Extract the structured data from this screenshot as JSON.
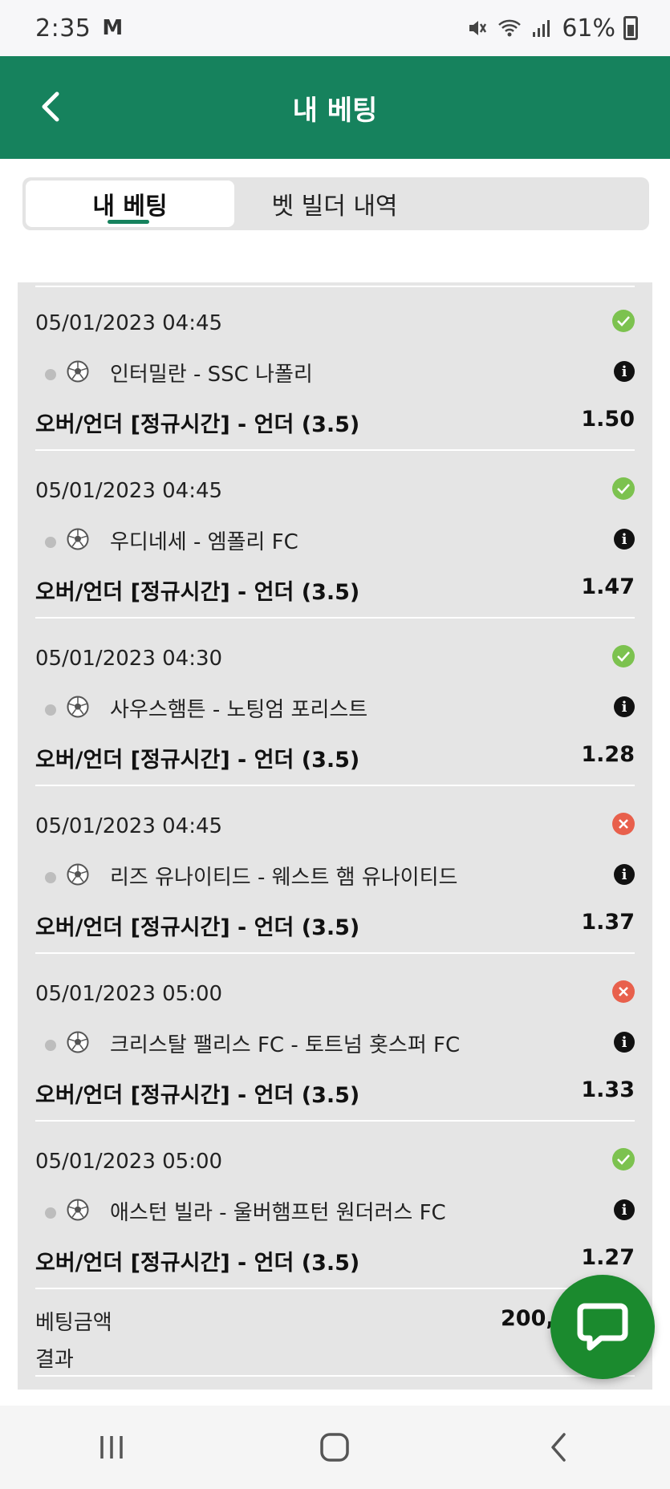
{
  "status_bar": {
    "time": "2:35",
    "mail_icon": "M",
    "battery": "61%"
  },
  "header": {
    "title": "내 베팅"
  },
  "tabs": [
    {
      "label": "내 베팅",
      "active": true
    },
    {
      "label": "벳 빌더 내역",
      "active": false
    }
  ],
  "bets": [
    {
      "date": "05/01/2023 04:45",
      "match": "인터밀란 - SSC 나폴리",
      "market": "오버/언더 [정규시간] - 언더 (3.5)",
      "odds": "1.50",
      "result": "win"
    },
    {
      "date": "05/01/2023 04:45",
      "match": "우디네세 - 엠폴리 FC",
      "market": "오버/언더 [정규시간] - 언더 (3.5)",
      "odds": "1.47",
      "result": "win"
    },
    {
      "date": "05/01/2023 04:30",
      "match": "사우스햄튼 - 노팅엄 포리스트",
      "market": "오버/언더 [정규시간] - 언더 (3.5)",
      "odds": "1.28",
      "result": "win"
    },
    {
      "date": "05/01/2023 04:45",
      "match": "리즈 유나이티드 - 웨스트 햄 유나이티드",
      "market": "오버/언더 [정규시간] - 언더 (3.5)",
      "odds": "1.37",
      "result": "loss"
    },
    {
      "date": "05/01/2023 05:00",
      "match": "크리스탈 팰리스 FC - 토트넘 홋스퍼 FC",
      "market": "오버/언더 [정규시간] - 언더 (3.5)",
      "odds": "1.33",
      "result": "loss"
    },
    {
      "date": "05/01/2023 05:00",
      "match": "애스턴 빌라 - 울버햄프턴 원더러스 FC",
      "market": "오버/언더 [정규시간] - 언더 (3.5)",
      "odds": "1.27",
      "result": "win"
    }
  ],
  "summary": {
    "stake_label": "베팅금액",
    "stake_value": "200,0",
    "result_label": "결과"
  },
  "colors": {
    "brand_green": "#16825d",
    "win": "#7cc24f",
    "loss": "#e8604c",
    "chat_fab": "#1b8a2e"
  },
  "icons": {
    "back": "chevron-left-icon",
    "status_win": "check-icon",
    "status_loss": "x-icon",
    "sport": "soccer-ball-icon",
    "info": "info-icon",
    "chat": "chat-bubble-icon"
  }
}
